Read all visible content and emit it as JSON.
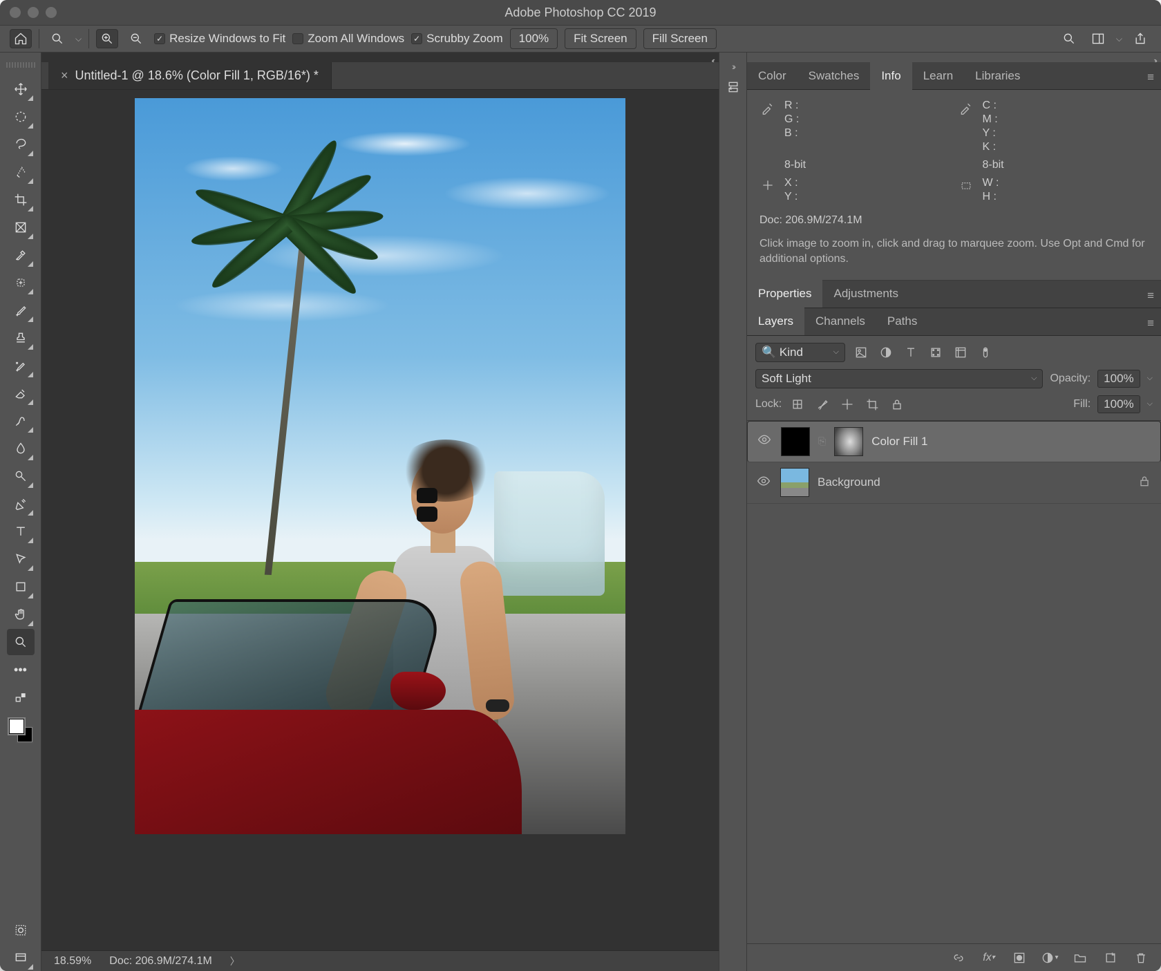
{
  "title": "Adobe Photoshop CC 2019",
  "options": {
    "resize": "Resize Windows to Fit",
    "zoomAll": "Zoom All Windows",
    "scrubby": "Scrubby Zoom",
    "zoomPct": "100%",
    "fit": "Fit Screen",
    "fill": "Fill Screen"
  },
  "doc": {
    "tab": "Untitled-1 @ 18.6% (Color Fill 1, RGB/16*) *",
    "zoom": "18.59%",
    "docinfo": "Doc: 206.9M/274.1M"
  },
  "info": {
    "tabs": [
      "Color",
      "Swatches",
      "Info",
      "Learn",
      "Libraries"
    ],
    "rgb": [
      "R :",
      "G :",
      "B :"
    ],
    "cmyk": [
      "C :",
      "M :",
      "Y :",
      "K :"
    ],
    "bit": "8-bit",
    "xy": [
      "X :",
      "Y :"
    ],
    "wh": [
      "W :",
      "H :"
    ],
    "doc": "Doc: 206.9M/274.1M",
    "help": "Click image to zoom in, click and drag to marquee zoom.  Use Opt and Cmd for additional options."
  },
  "props": {
    "tabs": [
      "Properties",
      "Adjustments"
    ]
  },
  "layersTabs": [
    "Layers",
    "Channels",
    "Paths"
  ],
  "layers": {
    "kind": "Kind",
    "blend": "Soft Light",
    "opacityLbl": "Opacity:",
    "opacity": "100%",
    "lockLbl": "Lock:",
    "fillLbl": "Fill:",
    "fill": "100%",
    "items": [
      {
        "name": "Color Fill 1"
      },
      {
        "name": "Background"
      }
    ]
  }
}
